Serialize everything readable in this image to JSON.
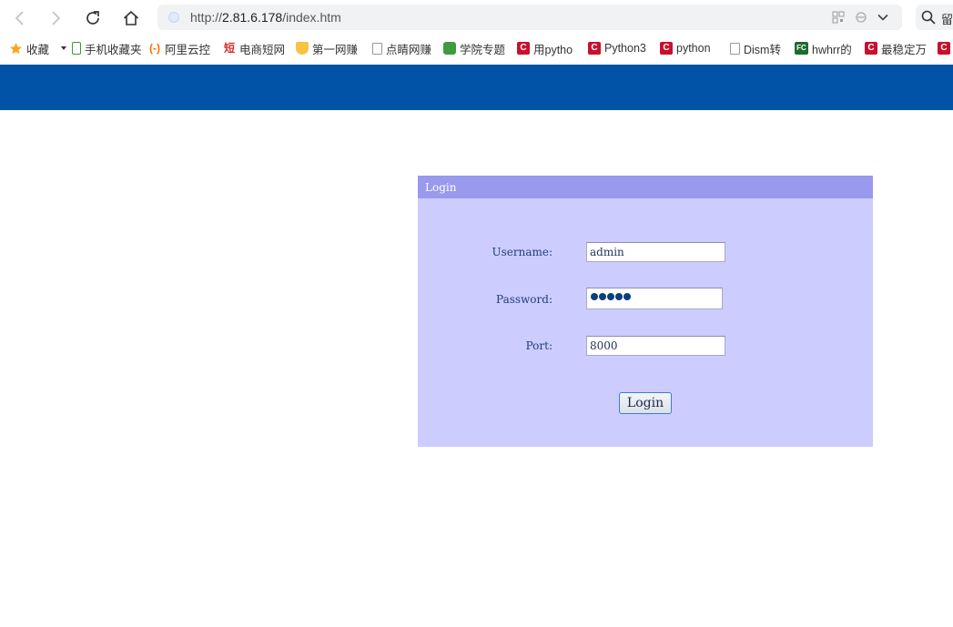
{
  "browser": {
    "url_prefix": "http://",
    "url_host": "2.81.6.178",
    "url_path": "/index.htm",
    "search_glyph": "留"
  },
  "bookmarks": {
    "favorites_label": "收藏",
    "items": [
      {
        "label": "手机收藏夹"
      },
      {
        "label": "阿里云控"
      },
      {
        "label": "电商短网"
      },
      {
        "label": "第一网赚"
      },
      {
        "label": "点睛网赚"
      },
      {
        "label": "学院专题"
      },
      {
        "label": "用pytho"
      },
      {
        "label": "Python3"
      },
      {
        "label": "python"
      },
      {
        "label": "Dism转"
      },
      {
        "label": "hwhrr的"
      },
      {
        "label": "最稳定万"
      }
    ]
  },
  "login": {
    "title": "Login",
    "username_label": "Username:",
    "username_value": "admin",
    "password_label": "Password:",
    "port_label": "Port:",
    "port_value": "8000",
    "button_label": "Login"
  },
  "colors": {
    "header": "#0053a6",
    "panel": "#ccccff",
    "panel_title": "#9999ee"
  }
}
